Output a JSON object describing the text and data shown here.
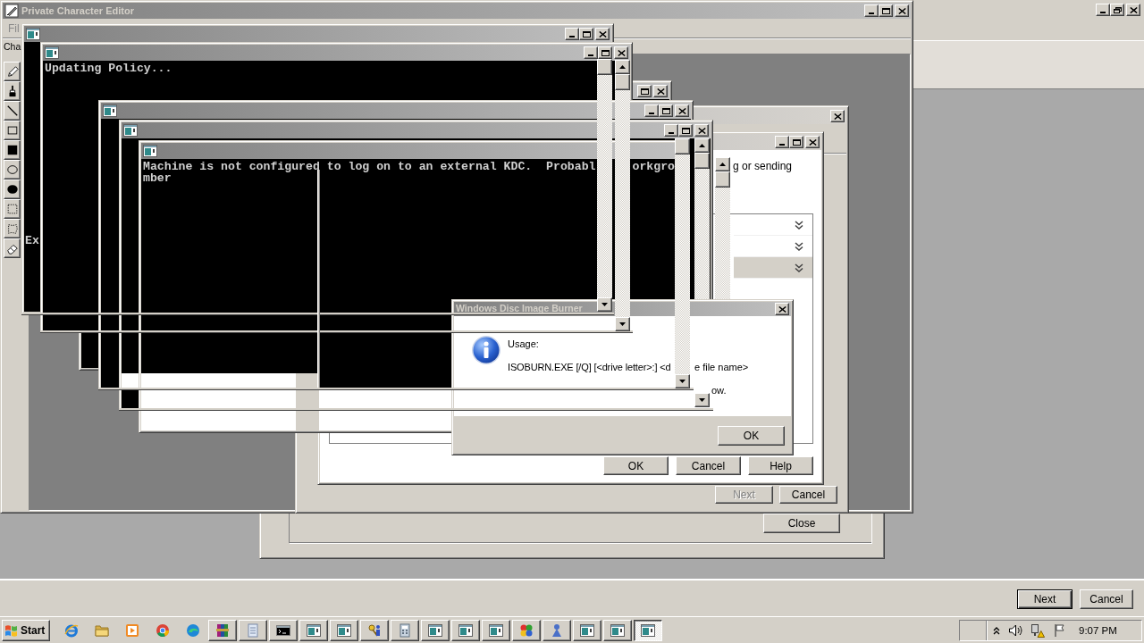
{
  "wizard_window": {
    "buttons": [
      {
        "label": "Next",
        "default": true
      },
      {
        "label": "Cancel",
        "default": false
      }
    ]
  },
  "back_dialog": {
    "buttons": [
      {
        "label": "Close"
      }
    ]
  },
  "character_editor": {
    "title": "Private Character Editor",
    "menu": [
      {
        "label": "Fil",
        "disabled": true
      }
    ],
    "toolbar_label": "Cha"
  },
  "wizard_dialog": {
    "buttons": [
      {
        "label": "Next",
        "disabled": true
      },
      {
        "label": "Cancel",
        "disabled": false
      }
    ]
  },
  "options_dialog": {
    "text": "g or sending",
    "list_rows": [
      {
        "selected": false
      },
      {
        "selected": false
      },
      {
        "selected": true
      }
    ],
    "buttons": [
      {
        "label": "OK"
      },
      {
        "label": "Cancel"
      },
      {
        "label": "Help"
      }
    ]
  },
  "consoles": [
    {
      "lines": [
        [
          "Ex"
        ]
      ]
    },
    {
      "lines": [
        [
          "Updating Policy..."
        ]
      ]
    },
    {
      "lines": [
        [
          "Machine is not configured to log on to an external KDC.  Probabl",
          "orkgro"
        ],
        [
          "mber"
        ]
      ]
    }
  ],
  "disc_image_dialog": {
    "title": "Windows Disc Image Burner",
    "lines": [
      [
        "Usage:"
      ],
      [
        "ISOBURN.EXE [/Q] [<drive letter>:] <d",
        "e file name>"
      ],
      [
        "ow."
      ]
    ],
    "button": "OK"
  },
  "taskbar": {
    "start": "Start",
    "tasks": [
      {
        "selected": false
      },
      {
        "selected": false
      },
      {
        "selected": false
      },
      {
        "selected": false
      },
      {
        "selected": false
      },
      {
        "selected": false
      },
      {
        "selected": false
      },
      {
        "selected": false
      },
      {
        "selected": false
      },
      {
        "selected": false
      },
      {
        "selected": false
      },
      {
        "selected": false
      },
      {
        "selected": false
      },
      {
        "selected": false
      },
      {
        "selected": true
      }
    ],
    "clock": "9:07 PM"
  }
}
